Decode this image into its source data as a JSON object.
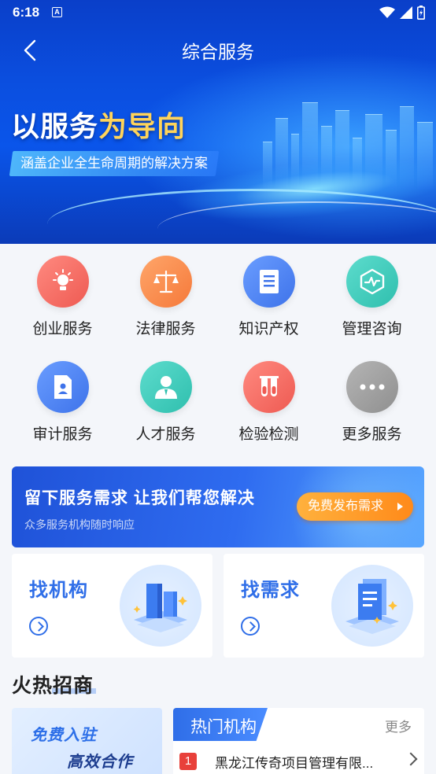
{
  "status_bar": {
    "time": "6:18",
    "notification": "A"
  },
  "nav": {
    "title": "综合服务"
  },
  "hero": {
    "headline_white": "以服务",
    "headline_gold": "为导向",
    "subline": "涵盖企业全生命周期的解决方案"
  },
  "services": [
    {
      "label": "创业服务",
      "icon": "lightbulb-icon",
      "color": "#f0655b"
    },
    {
      "label": "法律服务",
      "icon": "scales-icon",
      "color": "#fb8a45"
    },
    {
      "label": "知识产权",
      "icon": "book-icon",
      "color": "#4a82f0"
    },
    {
      "label": "管理咨询",
      "icon": "chart-shield-icon",
      "color": "#3fc8b8"
    },
    {
      "label": "审计服务",
      "icon": "document-icon",
      "color": "#4a82f0"
    },
    {
      "label": "人才服务",
      "icon": "person-icon",
      "color": "#3fc8b8"
    },
    {
      "label": "检验检测",
      "icon": "test-tubes-icon",
      "color": "#f0655b"
    },
    {
      "label": "更多服务",
      "icon": "more-dots-icon",
      "color": "#9a9a9a"
    }
  ],
  "demand_banner": {
    "title": "留下服务需求  让我们帮您解决",
    "subtitle": "众多服务机构随时响应",
    "button": "免费发布需求"
  },
  "find_cards": [
    {
      "title": "找机构"
    },
    {
      "title": "找需求"
    }
  ],
  "section": {
    "title": "火热招商"
  },
  "promo": {
    "line1": "免费入驻",
    "line2": "高效合作"
  },
  "hot": {
    "tab": "热门机构",
    "more": "更多",
    "items": [
      {
        "rank": "1",
        "name": "黑龙江传奇项目管理有限..."
      }
    ]
  }
}
